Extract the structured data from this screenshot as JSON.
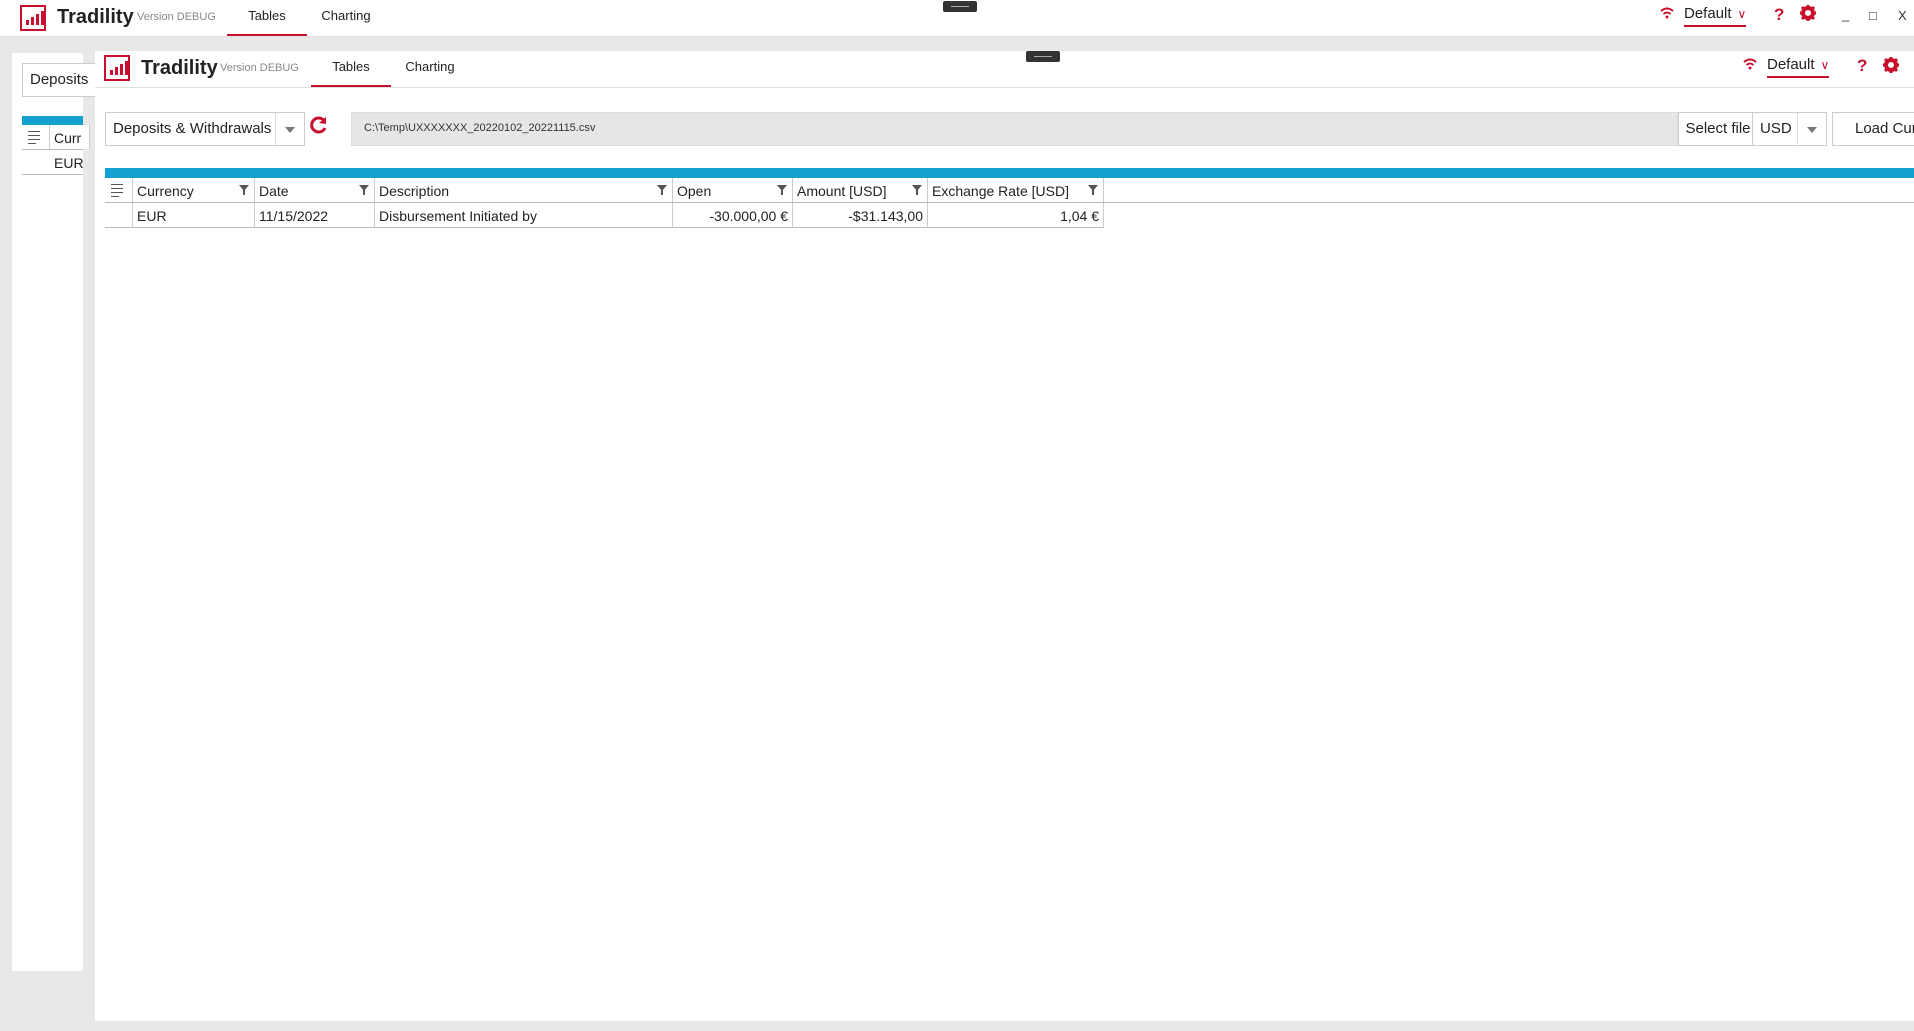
{
  "app": {
    "title": "Tradility",
    "version": "Version DEBUG"
  },
  "tabs": {
    "tables": "Tables",
    "charting": "Charting"
  },
  "profile": {
    "label": "Default"
  },
  "window_controls": {
    "minimize": "_",
    "maximize": "□",
    "close": "X"
  },
  "icons": {
    "help": "?",
    "settings": "✹",
    "wifi": "📶",
    "refresh": "⟳"
  },
  "colors": {
    "accent": "#c8102e",
    "grid_bar": "#14a0d0"
  },
  "back_window": {
    "dropdown_label": "Deposits",
    "col_currency": "Curr",
    "row_currency": "EUR"
  },
  "toolbar": {
    "report_type": "Deposits & Withdrawals",
    "file_path": "C:\\Temp\\UXXXXXXX_20220102_20221115.csv",
    "select_file": "Select file",
    "currency": "USD",
    "load_button": "Load Cur"
  },
  "table": {
    "columns": [
      "Currency",
      "Date",
      "Description",
      "Open",
      "Amount [USD]",
      "Exchange Rate [USD]"
    ],
    "rows": [
      {
        "currency": "EUR",
        "date": "11/15/2022",
        "description": "Disbursement Initiated by",
        "open": "-30.000,00 €",
        "amount": "-$31.143,00",
        "rate": "1,04 €"
      }
    ]
  }
}
